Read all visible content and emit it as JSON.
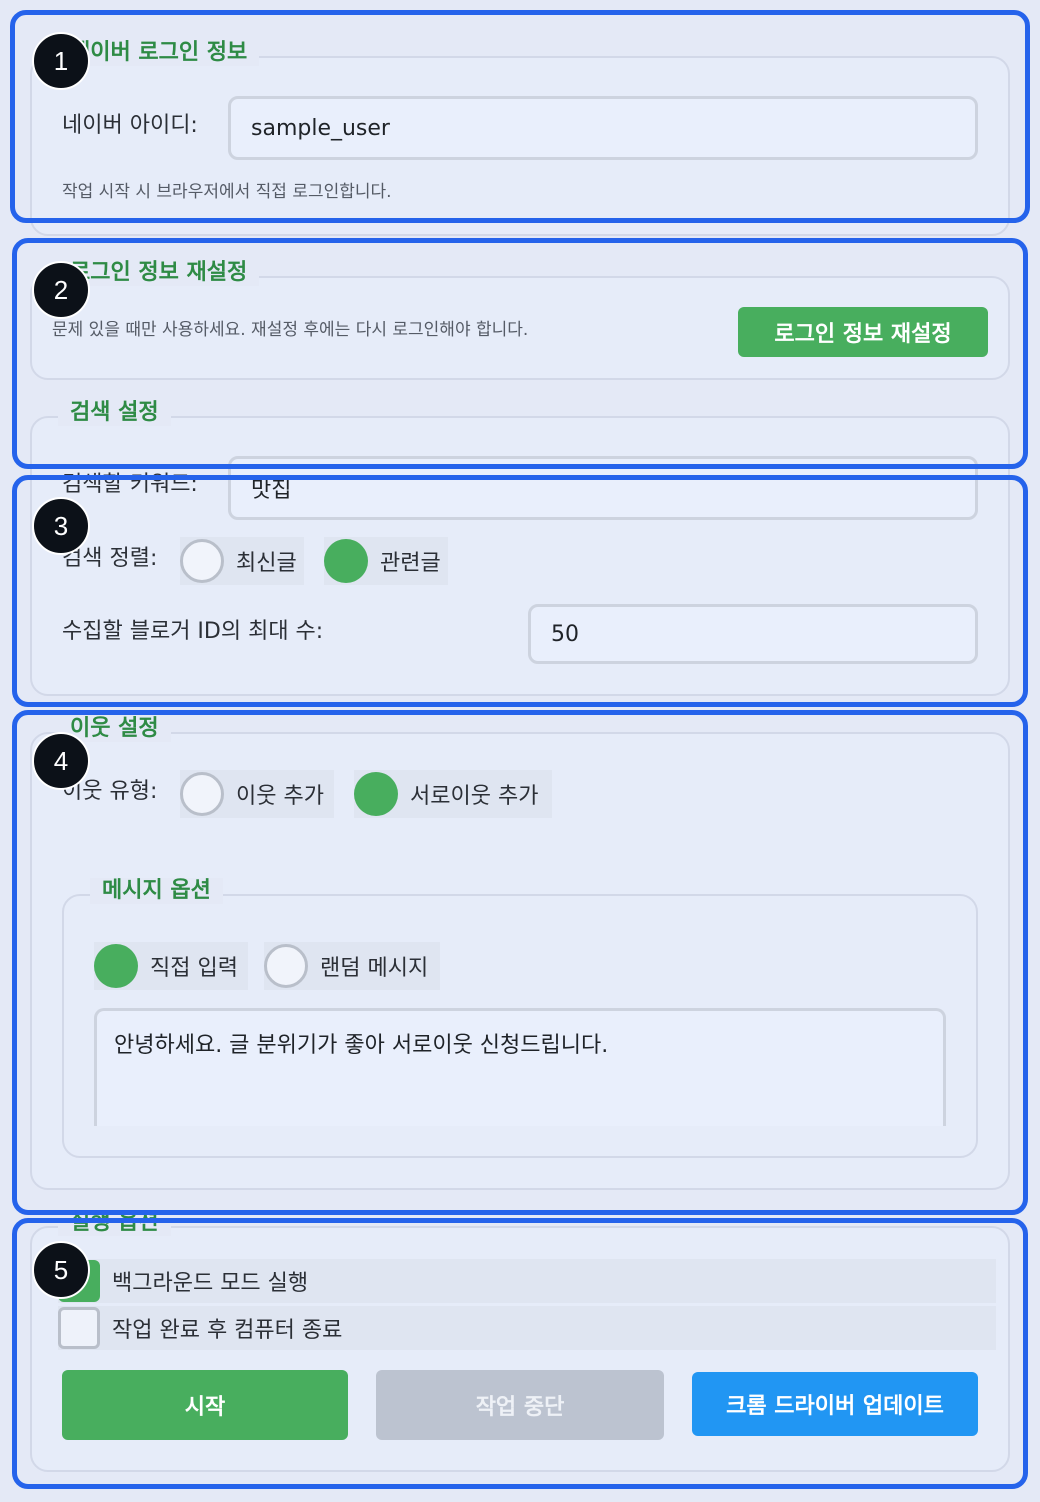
{
  "login": {
    "legend": "네이버 로그인 정보",
    "id_label": "네이버 아이디:",
    "id_value": "sample_user",
    "help": "작업 시작 시 브라우저에서 직접 로그인합니다."
  },
  "reset": {
    "legend": "로그인 정보 재설정",
    "help": "문제 있을 때만 사용하세요. 재설정 후에는 다시 로그인해야 합니다.",
    "button": "로그인 정보 재설정"
  },
  "search": {
    "legend": "검색 설정",
    "keyword_label": "검색할 키워드:",
    "keyword_value": "맛집",
    "sort_label": "검색 정렬:",
    "sort_options": [
      "최신글",
      "관련글"
    ],
    "sort_selected": "관련글",
    "max_label": "수집할 블로거 ID의 최대 수:",
    "max_value": "50"
  },
  "neighbor": {
    "legend": "이웃 설정",
    "type_label": "이웃 유형:",
    "type_options": [
      "이웃 추가",
      "서로이웃 추가"
    ],
    "type_selected": "서로이웃 추가",
    "message": {
      "legend": "메시지 옵션",
      "options": [
        "직접 입력",
        "랜덤 메시지"
      ],
      "selected": "직접 입력",
      "text": "안녕하세요. 글 분위기가 좋아 서로이웃 신청드립니다."
    }
  },
  "run": {
    "legend": "실행 옵션",
    "checks": [
      {
        "label": "백그라운드 모드 실행",
        "checked": true
      },
      {
        "label": "작업 완료 후 컴퓨터 종료",
        "checked": false
      }
    ],
    "buttons": {
      "start": "시작",
      "stop": "작업 중단",
      "update": "크롬 드라이버 업데이트"
    }
  },
  "badges": [
    "1",
    "2",
    "3",
    "4",
    "5"
  ],
  "colors": {
    "accent_green": "#48ae5e",
    "legend_green": "#2e8b45",
    "highlight_blue": "#2563eb",
    "update_blue": "#2196f3",
    "disabled_gray": "#bcc3d0"
  }
}
